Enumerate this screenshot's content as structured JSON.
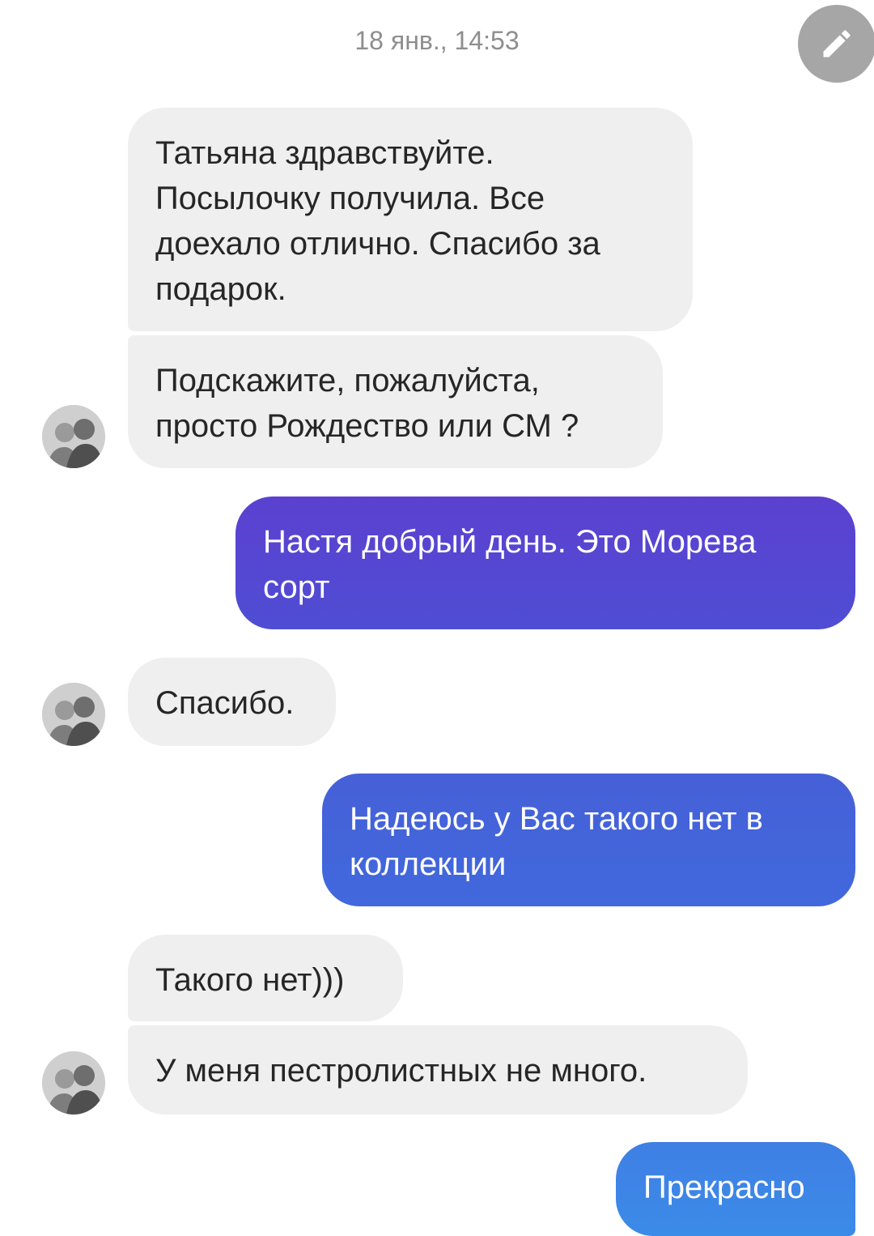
{
  "conversation": {
    "date_divider": "18 янв., 14:53",
    "messages": [
      {
        "direction": "incoming",
        "text": "Татьяна здравствуйте.\nПосылочку получила. Все\nдоехало отлично. Спасибо за\nподарок."
      },
      {
        "direction": "incoming",
        "text": "Подскажите, пожалуйста,\nпросто Рождество или СМ ?"
      },
      {
        "direction": "outgoing",
        "text": "Настя добрый день. Это Морева\nсорт"
      },
      {
        "direction": "incoming",
        "text": "Спасибо."
      },
      {
        "direction": "outgoing",
        "text": "Надеюсь у Вас такого нет в\nколлекции"
      },
      {
        "direction": "incoming",
        "text": "Такого нет)))"
      },
      {
        "direction": "incoming",
        "text": "У меня пестролистных не много."
      },
      {
        "direction": "outgoing",
        "text": "Прекрасно"
      }
    ]
  },
  "colors": {
    "incoming_bubble": "#efefef",
    "outgoing_gradient_top": "#5b41d0",
    "outgoing_gradient_mid": "#4366dc",
    "outgoing_gradient_bottom": "#3b8be8",
    "fab": "#a6a6a6"
  },
  "icons": {
    "edit_fab": "pencil-icon",
    "avatar": "contact-photo"
  }
}
